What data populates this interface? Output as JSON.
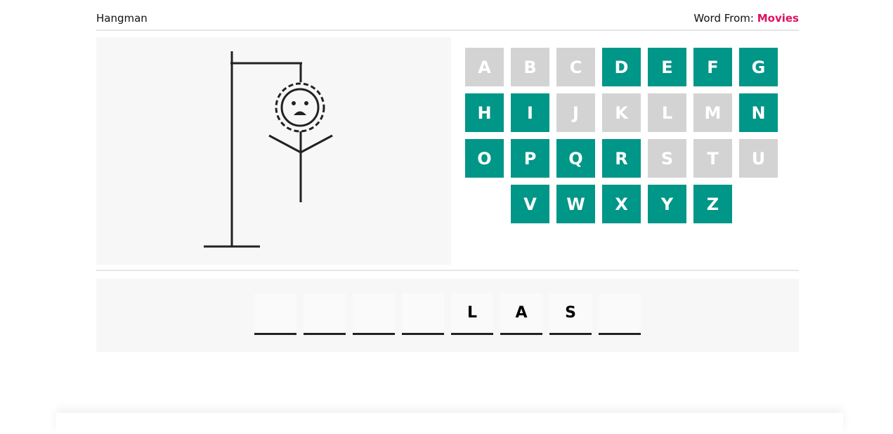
{
  "header": {
    "title": "Hangman",
    "word_from_label": "Word From: ",
    "category": "Movies"
  },
  "colors": {
    "available_key": "#009688",
    "used_key": "#d3d3d3",
    "category": "#e0115f"
  },
  "keyboard": {
    "rows": [
      [
        {
          "letter": "A",
          "state": "used"
        },
        {
          "letter": "B",
          "state": "used"
        },
        {
          "letter": "C",
          "state": "used"
        },
        {
          "letter": "D",
          "state": "available"
        },
        {
          "letter": "E",
          "state": "available"
        },
        {
          "letter": "F",
          "state": "available"
        },
        {
          "letter": "G",
          "state": "available"
        }
      ],
      [
        {
          "letter": "H",
          "state": "available"
        },
        {
          "letter": "I",
          "state": "available"
        },
        {
          "letter": "J",
          "state": "used"
        },
        {
          "letter": "K",
          "state": "used"
        },
        {
          "letter": "L",
          "state": "used"
        },
        {
          "letter": "M",
          "state": "used"
        },
        {
          "letter": "N",
          "state": "available"
        }
      ],
      [
        {
          "letter": "O",
          "state": "available"
        },
        {
          "letter": "P",
          "state": "available"
        },
        {
          "letter": "Q",
          "state": "available"
        },
        {
          "letter": "R",
          "state": "available"
        },
        {
          "letter": "S",
          "state": "used"
        },
        {
          "letter": "T",
          "state": "used"
        },
        {
          "letter": "U",
          "state": "used"
        }
      ],
      [
        {
          "letter": "V",
          "state": "available"
        },
        {
          "letter": "W",
          "state": "available"
        },
        {
          "letter": "X",
          "state": "available"
        },
        {
          "letter": "Y",
          "state": "available"
        },
        {
          "letter": "Z",
          "state": "available"
        }
      ]
    ]
  },
  "word": {
    "slots": [
      "",
      "",
      "",
      "",
      "L",
      "A",
      "S",
      ""
    ]
  },
  "hangman": {
    "face": "sad",
    "parts_drawn": [
      "gallows",
      "head",
      "body",
      "arms"
    ]
  }
}
